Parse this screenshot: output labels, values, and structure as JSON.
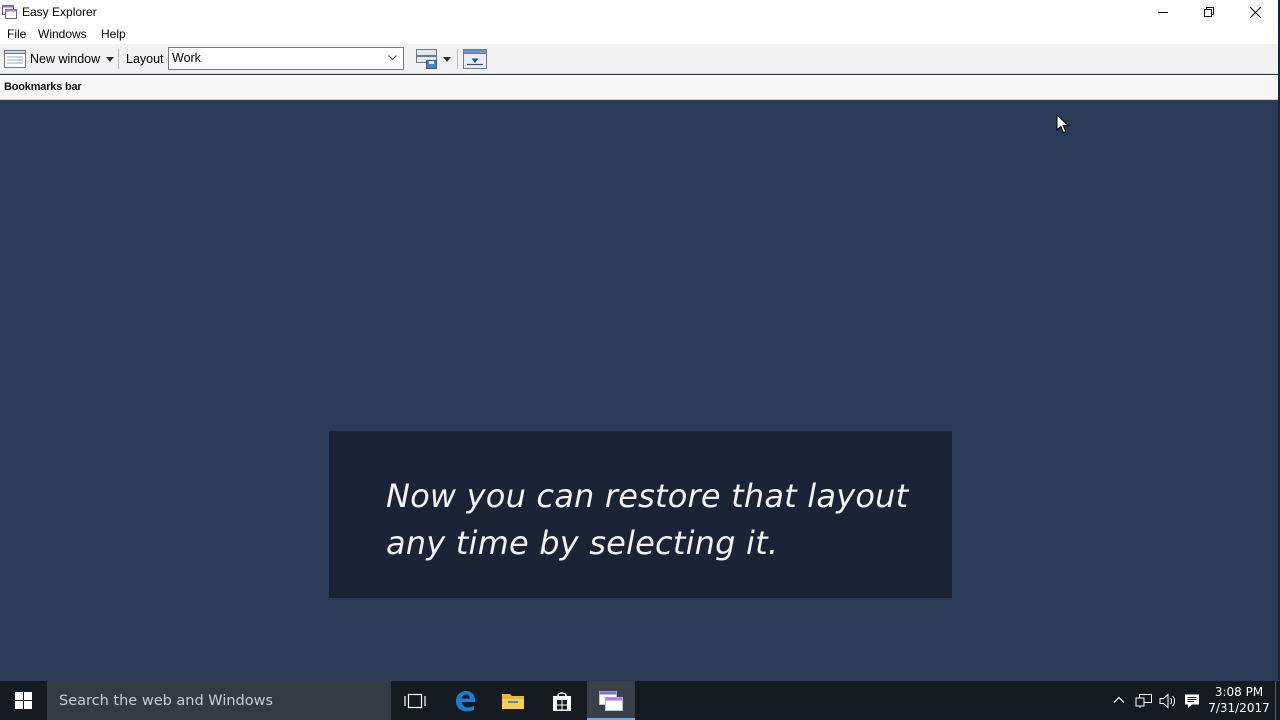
{
  "window": {
    "title": "Easy Explorer",
    "controls": {
      "minimize": "minimize",
      "maximize": "restore",
      "close": "close"
    }
  },
  "menu": {
    "items": [
      {
        "label": "File"
      },
      {
        "label": "Windows"
      },
      {
        "label": "Help"
      }
    ]
  },
  "toolbar": {
    "new_window_label": "New window",
    "layout_label": "Layout",
    "layout_value": "Work"
  },
  "bookmarks": {
    "label": "Bookmarks bar"
  },
  "caption": {
    "line1": "Now you can restore that layout",
    "line2": "any time by selecting it."
  },
  "taskbar": {
    "search_placeholder": "Search the web and Windows",
    "clock_time": "3:08 PM",
    "clock_date": "7/31/2017"
  },
  "colors": {
    "desktop": "#2a3b58",
    "caption_bg": "#1b2337",
    "taskbar": "#161b22",
    "accent": "#7aa9e0"
  }
}
